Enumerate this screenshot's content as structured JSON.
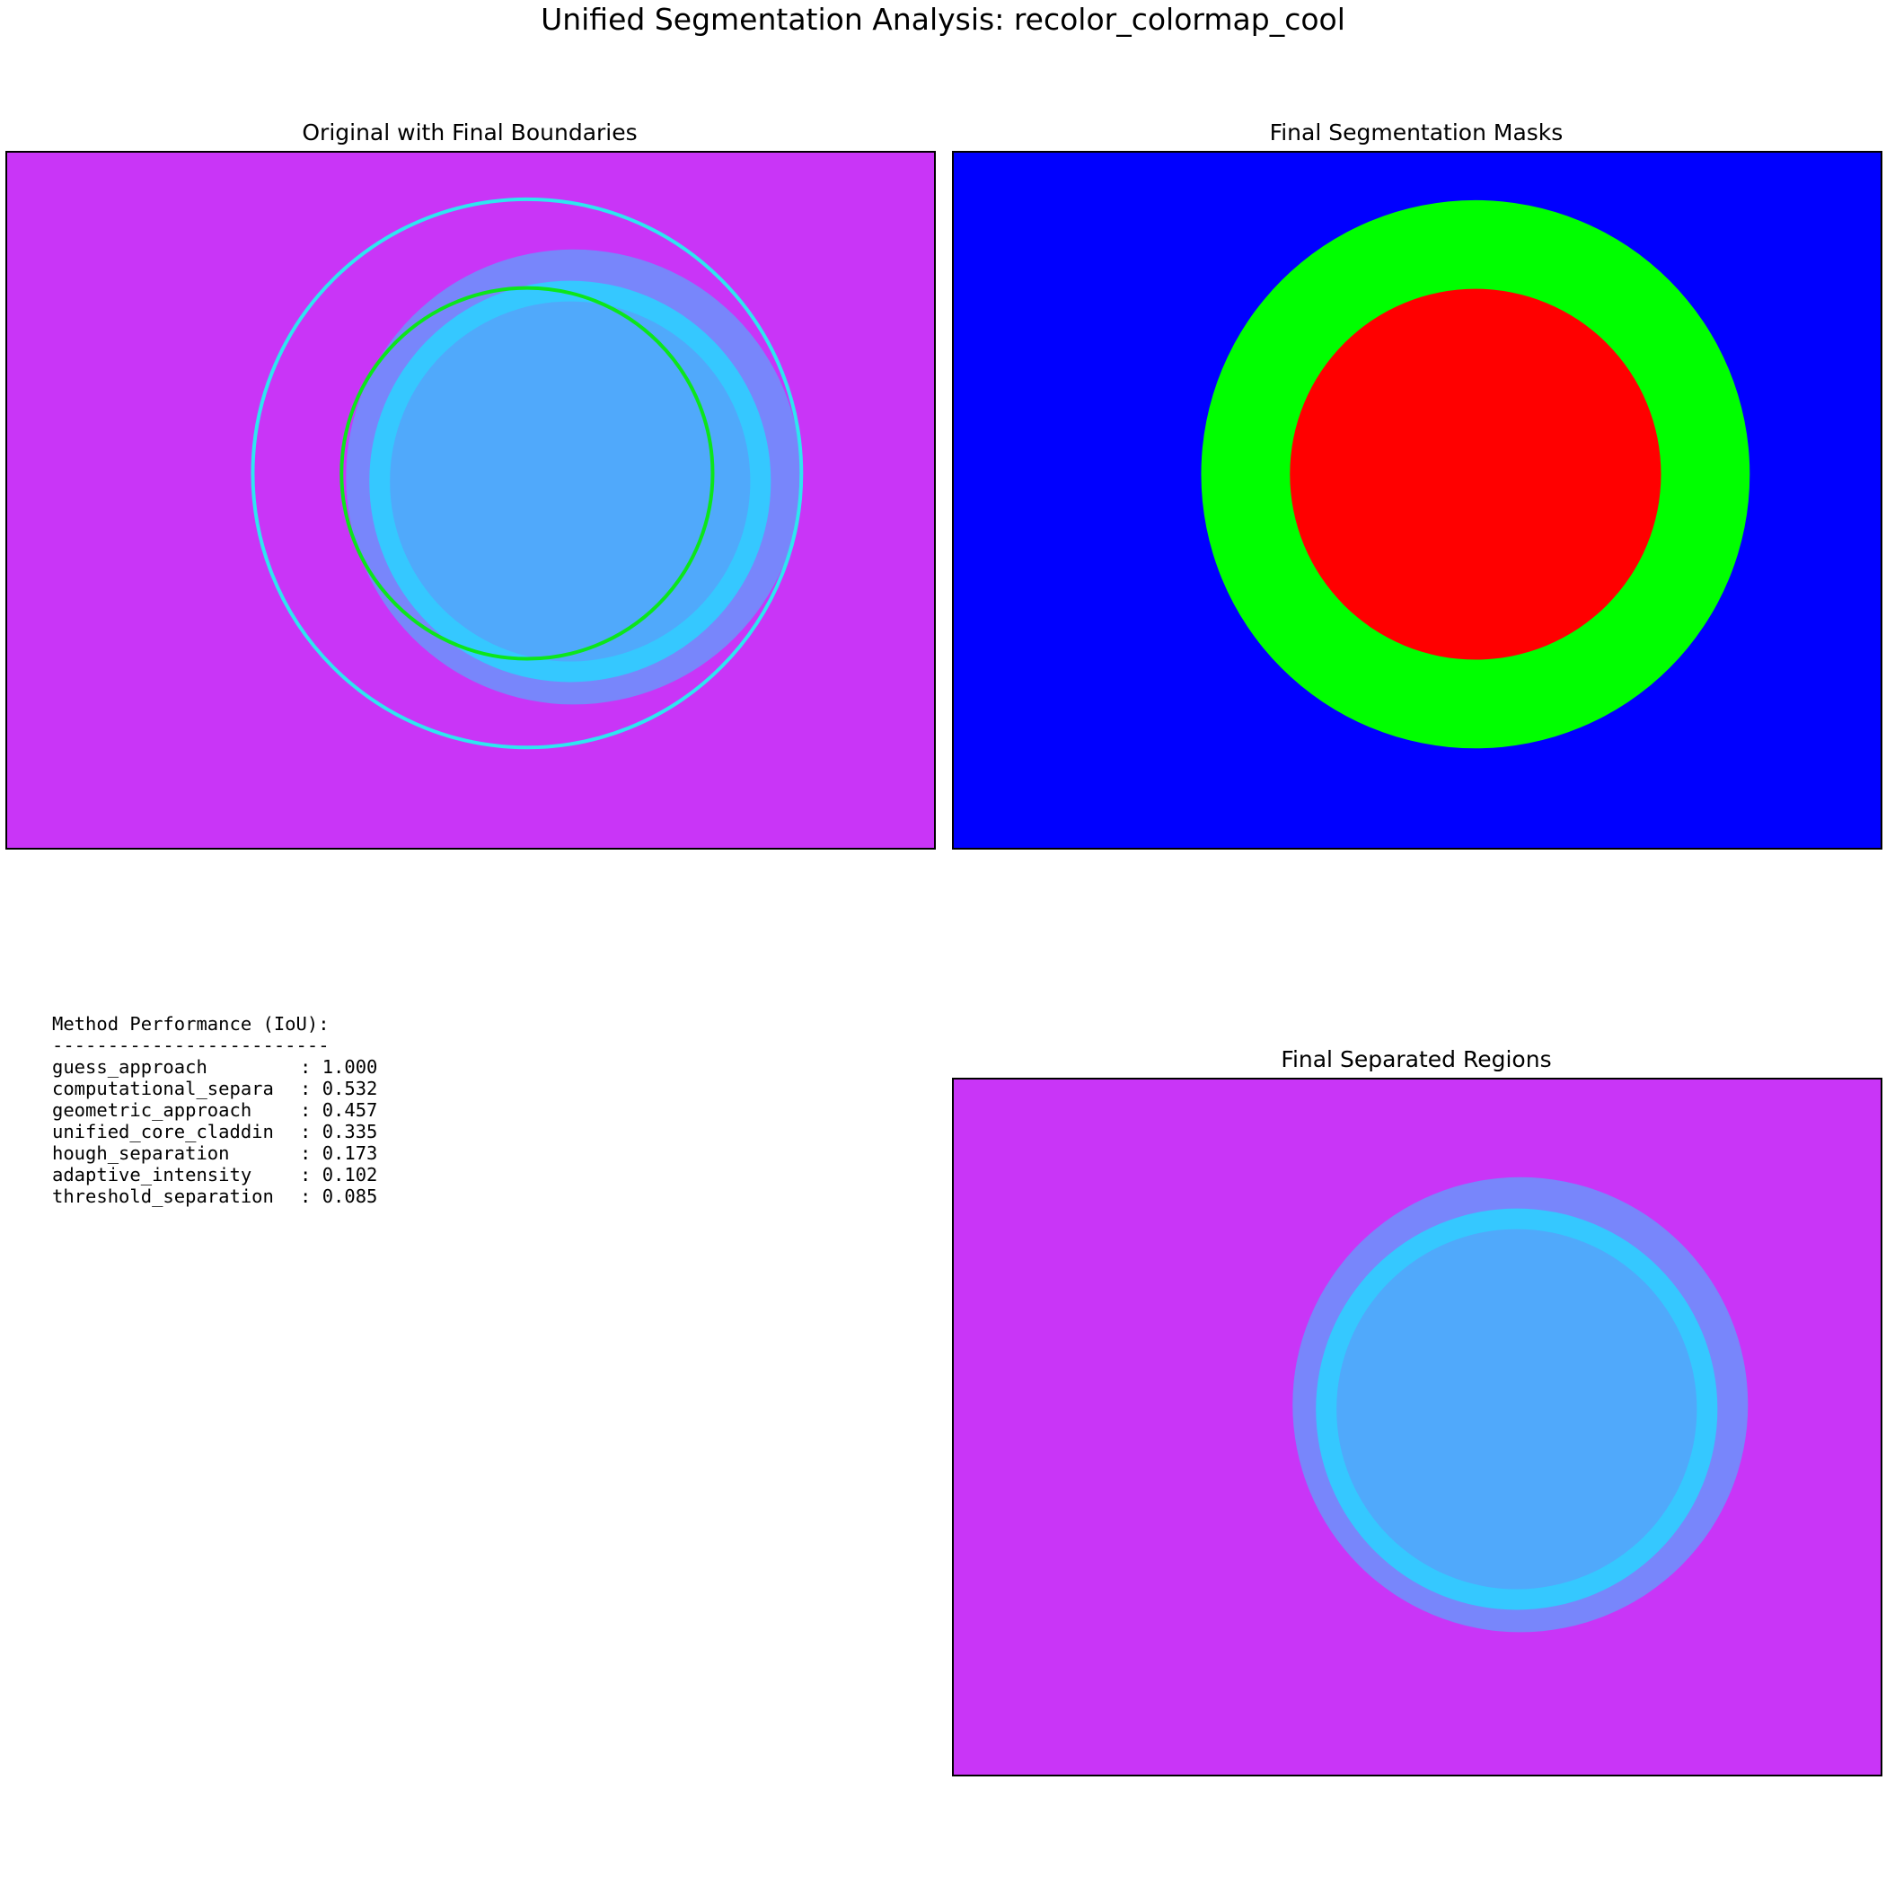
{
  "figure": {
    "title": "Unified Segmentation Analysis: recolor_colormap_cool"
  },
  "panels": {
    "original": {
      "title": "Original with Final Boundaries"
    },
    "masks": {
      "title": "Final Segmentation Masks"
    },
    "separated": {
      "title": "Final Separated Regions"
    }
  },
  "performance": {
    "heading": "Method Performance (IoU):",
    "rule": "-------------------------",
    "methods": [
      {
        "name": "guess_approach",
        "iou": "1.000"
      },
      {
        "name": "computational_separa",
        "iou": "0.532"
      },
      {
        "name": "geometric_approach",
        "iou": "0.457"
      },
      {
        "name": "unified_core_claddin",
        "iou": "0.335"
      },
      {
        "name": "hough_separation",
        "iou": "0.173"
      },
      {
        "name": "adaptive_intensity",
        "iou": "0.102"
      },
      {
        "name": "threshold_separation",
        "iou": "0.085"
      }
    ]
  },
  "colors": {
    "background_magenta": "#c935f7",
    "ring_cyan": "#35c8ff",
    "core_blue": "#50a9fb",
    "boundary_cyan": "#2ee6f0",
    "boundary_green": "#0ce61a",
    "mask_core": "#ff0000",
    "mask_cladding": "#00ff00",
    "mask_background": "#0000ff"
  }
}
